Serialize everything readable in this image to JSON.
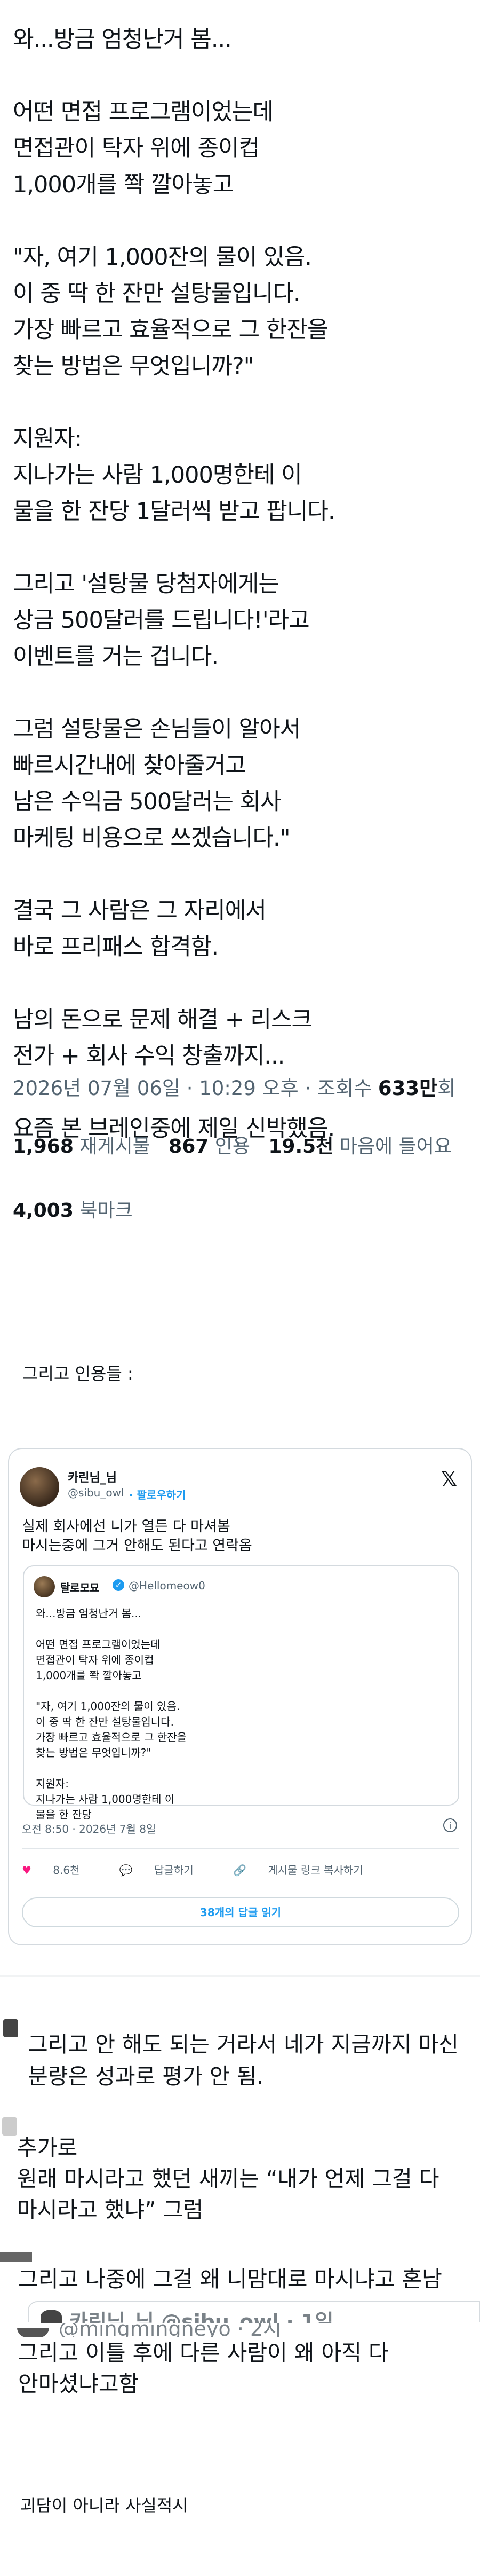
{
  "tweet": {
    "lines": [
      "와...방금  엄청난거 봄...",
      "",
      "어떤 면접 프로그램이었는데",
      "면접관이 탁자 위에 종이컵",
      "1,000개를 쫙 깔아놓고",
      "",
      "\"자, 여기 1,000잔의 물이 있음.",
      "이 중 딱 한 잔만 설탕물입니다.",
      "가장 빠르고 효율적으로 그 한잔을",
      "찾는 방법은 무엇입니까?\"",
      "",
      "지원자:",
      "지나가는 사람 1,000명한테 이",
      "물을 한 잔당 1달러씩 받고 팝니다.",
      "",
      "그리고 '설탕물 당첨자에게는",
      "상금 500달러를 드립니다!'라고",
      "이벤트를 거는 겁니다.",
      "",
      "그럼 설탕물은 손님들이 알아서",
      "빠르시간내에 찾아줄거고",
      "남은 수익금 500달러는 회사",
      "마케팅 비용으로 쓰겠습니다.\"",
      "",
      "결국 그 사람은 그 자리에서",
      "바로 프리패스 합격함.",
      "",
      "남의 돈으로 문제 해결 + 리스크",
      "전가 + 회사 수익 창출까지...",
      "",
      "요즘 본 브레인중에 제일 신박했음."
    ],
    "meta_time": "2026년 07월 06일 · 10:29 오후 · 조회수 ",
    "meta_views": "633만",
    "meta_views_suffix": "회",
    "retweets": "1,968",
    "retweets_label": "재게시물",
    "quotes": "867",
    "quotes_label": "인용",
    "likes": "19.5천",
    "likes_label": "마음에 들어요",
    "bookmarks": "4,003",
    "bookmarks_label": "북마크"
  },
  "quotes_label": "그리고 인용들 :",
  "card": {
    "name": "카린님_님",
    "handle": "@sibu_owl",
    "follow": "· 팔로우하기",
    "body_lines": [
      "실제 회사에선 니가 열든 다 마셔봄",
      "마시는중에 그거 안해도 된다고 연락옴"
    ],
    "inner_name": "탈로모묘",
    "inner_handle": "@Hellomeow0",
    "inner_lines": [
      "와...방금  엄청난거 봄...",
      "",
      "어떤 면접 프로그램이었는데",
      "면접관이 탁자 위에 종이컵",
      "1,000개를 쫙 깔아놓고",
      "",
      "\"자, 여기 1,000잔의 물이 있음.",
      "이 중 딱 한 잔만 설탕물입니다.",
      "가장 빠르고 효율적으로 그 한잔을",
      "찾는 방법은 무엇입니까?\"",
      "",
      "지원자:",
      "지나가는 사람 1,000명한테 이",
      "물을 한 잔당"
    ],
    "time": "오전 8:50 · 2026년 7월 8일",
    "likes": "8.6천",
    "reply": "답글하기",
    "copy_link": "게시물 링크 복사하기",
    "read_replies": "38개의 답글 읽기"
  },
  "replies": {
    "r1_line1": "그리고 안 해도 되는 거라서 네가 지금까지 마신",
    "r1_line2": "분량은 성과로 평가 안 됨.",
    "r2_line1": "추가로",
    "r2_line2": "원래 마시라고 했던 새끼는 “내가 언제 그걸 다",
    "r2_line3": "마시라고 했냐” 그럼",
    "r3_line1": "그리고 나중에 그걸 왜 니맘대로 마시냐고 혼남",
    "r3_faded": "카린님_님  @sibu_owl · 1일",
    "r4_faded": "@mingmingneyo · 2시",
    "r4_line1": "그리고 이틀 후에 다른 사람이 왜 아직 다",
    "r4_line2": "안마셨냐고함"
  },
  "footnote": "괴담이 아니라 사실적시"
}
